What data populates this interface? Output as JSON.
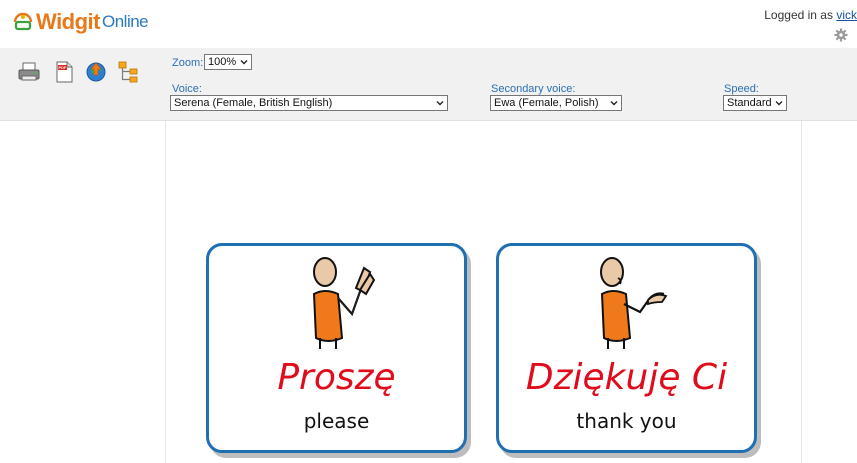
{
  "app": {
    "logo_brand": "Widgit",
    "logo_suffix": "Online"
  },
  "header": {
    "logged_in_prefix": "Logged in as",
    "username": "vick"
  },
  "toolbar": {
    "zoom_label": "Zoom:",
    "zoom_value": "100%",
    "voice_label": "Voice:",
    "voice_value": "Serena (Female, British English)",
    "secondary_voice_label": "Secondary voice:",
    "secondary_voice_value": "Ewa (Female, Polish)",
    "speed_label": "Speed:",
    "speed_value": "Standard"
  },
  "icons": [
    "print-icon",
    "pdf-icon",
    "publish-globe-icon",
    "structure-icon",
    "settings-gear-icon"
  ],
  "cards": [
    {
      "word": "Proszę",
      "gloss": "please"
    },
    {
      "word": "Dziękuję Ci",
      "gloss": "thank you"
    }
  ],
  "colors": {
    "accent_blue": "#1f6fb2",
    "word_red": "#e00b1b",
    "logo_orange": "#e8791a"
  }
}
